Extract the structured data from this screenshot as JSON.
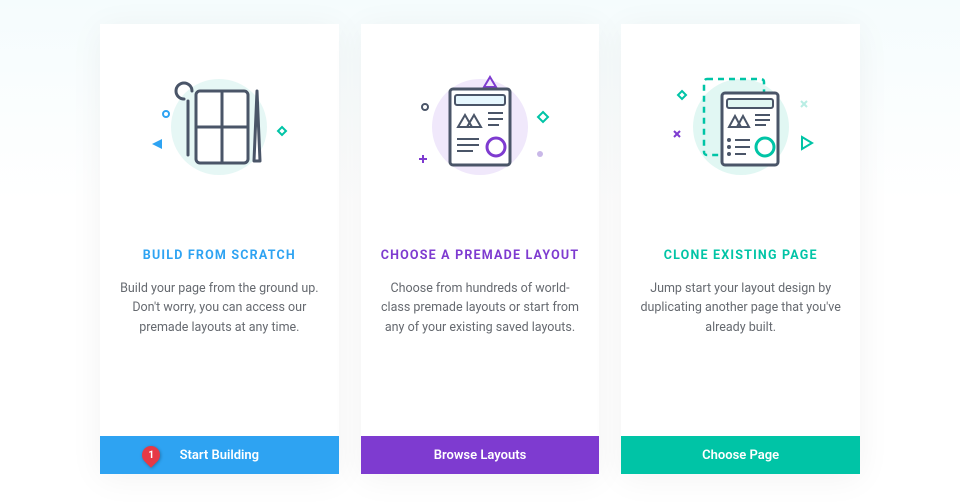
{
  "cards": [
    {
      "title": "BUILD FROM SCRATCH",
      "desc": "Build your page from the ground up. Don't worry, you can access our premade layouts at any time.",
      "button": "Start Building"
    },
    {
      "title": "CHOOSE A PREMADE LAYOUT",
      "desc": "Choose from hundreds of world-class premade layouts or start from any of your existing saved layouts.",
      "button": "Browse Layouts"
    },
    {
      "title": "CLONE EXISTING PAGE",
      "desc": "Jump start your layout design by duplicating another page that you've already built.",
      "button": "Choose Page"
    }
  ],
  "marker": {
    "number": "1"
  }
}
